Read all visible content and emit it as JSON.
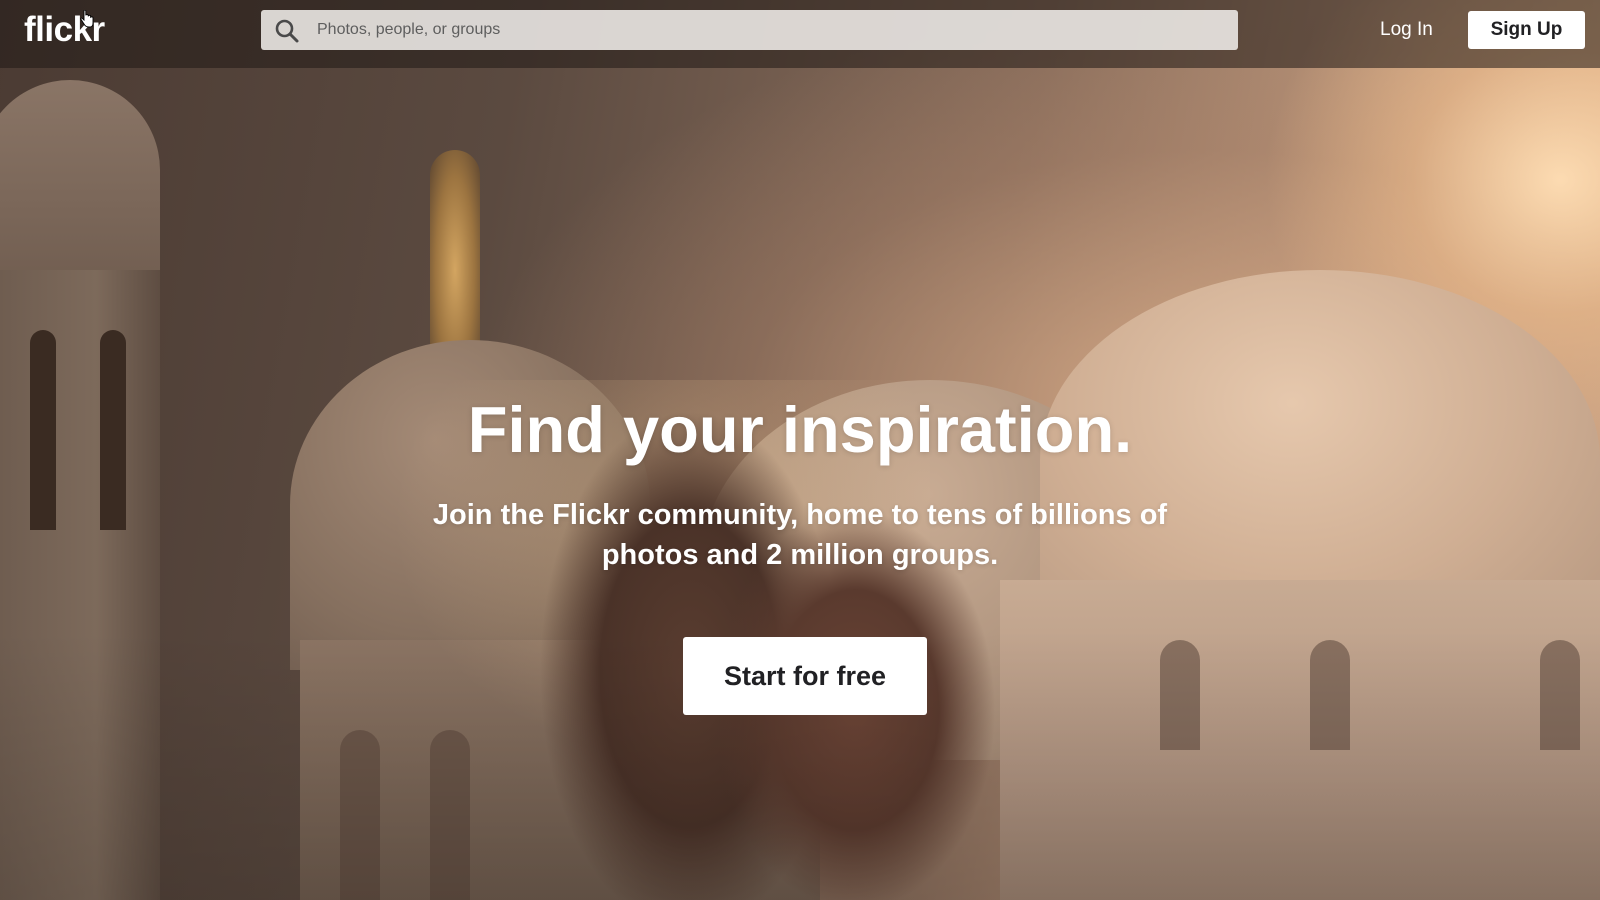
{
  "header": {
    "logo_text": "flickr",
    "search": {
      "placeholder": "Photos, people, or groups",
      "value": ""
    },
    "login_label": "Log In",
    "signup_label": "Sign Up"
  },
  "hero": {
    "title": "Find your inspiration.",
    "subtitle_line1": "Join the Flickr community, home to tens of billions of",
    "subtitle_line2": "photos and 2 million groups.",
    "cta_label": "Start for free"
  },
  "icons": {
    "search": "search-icon",
    "cursor": "hand-cursor-icon"
  },
  "colors": {
    "header_bg": "#211a16",
    "button_bg": "#ffffff",
    "button_text": "#212124",
    "text_light": "#ffffff"
  }
}
